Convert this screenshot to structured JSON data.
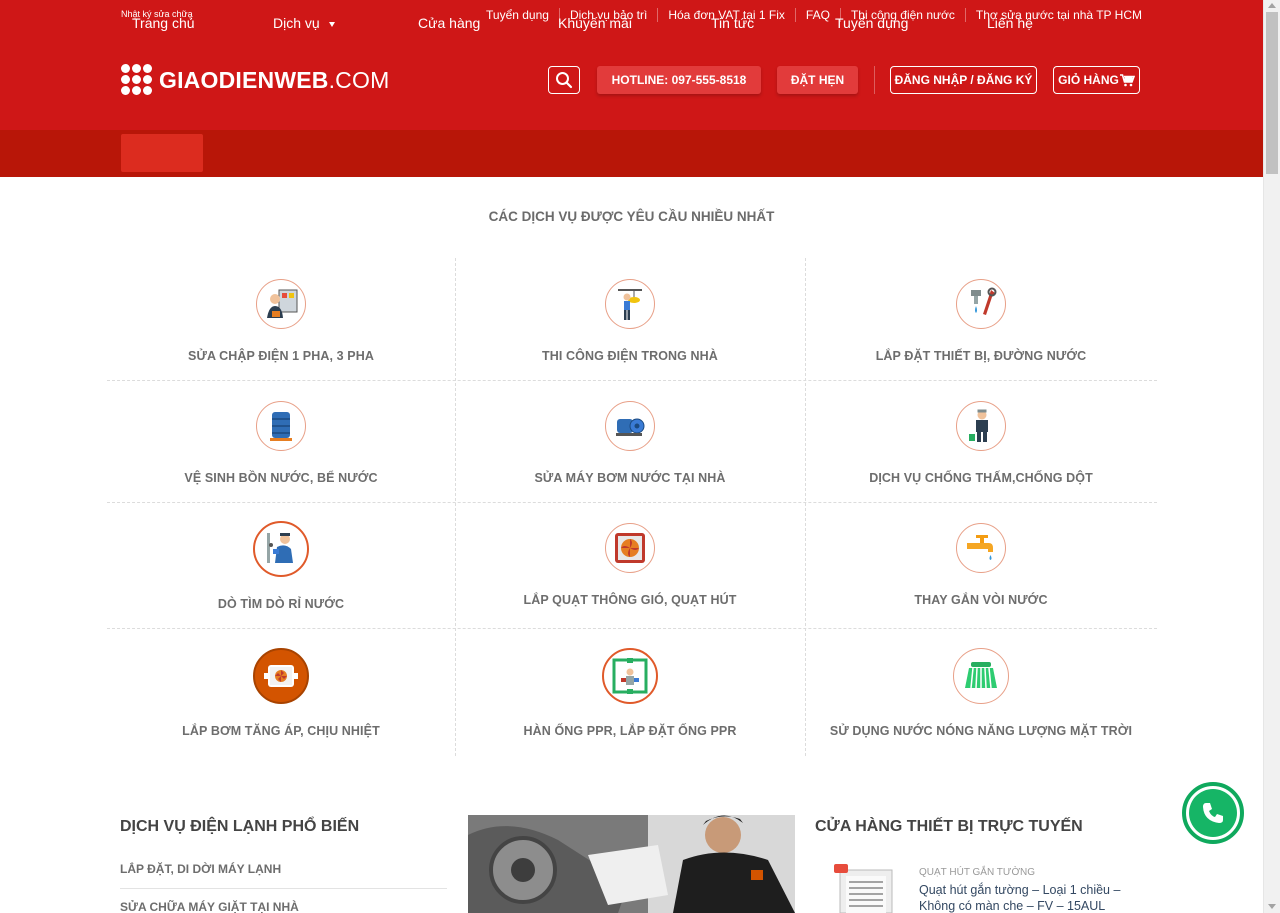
{
  "topbar": {
    "left_text": "Nhật ký sửa chữa",
    "links": [
      "Tuyển dụng",
      "Dịch vụ bảo trì",
      "Hóa đơn VAT tại 1 Fix",
      "FAQ",
      "Thi công điện nước",
      "Thợ sửa nước tại nhà TP HCM"
    ]
  },
  "header": {
    "logo_bold": "GIAODIENWEB",
    "logo_thin": ".COM",
    "hotline": "HOTLINE: 097-555-8518",
    "book": "ĐẶT HẸN",
    "login": "ĐĂNG NHẬP / ĐĂNG KÝ",
    "cart": "GIỎ HÀNG"
  },
  "nav": {
    "items": [
      "Trang chủ",
      "Dịch vụ",
      "Cửa hàng",
      "Khuyến mãi",
      "Tin tức",
      "Tuyển dụng",
      "Liên hệ"
    ]
  },
  "services": {
    "title": "CÁC DỊCH VỤ ĐƯỢC YÊU CẦU NHIỀU NHẤT",
    "items": [
      {
        "label": "SỬA CHẬP ĐIỆN 1 PHA, 3 PHA",
        "icon": "electrician-panel-icon"
      },
      {
        "label": "THI CÔNG ĐIỆN TRONG NHÀ",
        "icon": "ladder-worker-icon"
      },
      {
        "label": "LẮP ĐẶT THIẾT BỊ, ĐƯỜNG NƯỚC",
        "icon": "wrench-faucet-icon"
      },
      {
        "label": "VỆ SINH BỒN NƯỚC, BỂ NƯỚC",
        "icon": "water-tank-icon"
      },
      {
        "label": "SỬA MÁY BƠM NƯỚC TẠI NHÀ",
        "icon": "water-pump-icon"
      },
      {
        "label": "DỊCH VỤ CHỐNG THẤM,CHỐNG DỘT",
        "icon": "painter-icon"
      },
      {
        "label": "DÒ TÌM DÒ RỈ NƯỚC",
        "icon": "leak-detection-icon"
      },
      {
        "label": "LẮP QUẠT THÔNG GIÓ, QUẠT HÚT",
        "icon": "exhaust-fan-icon"
      },
      {
        "label": "THAY GẮN VÒI NƯỚC",
        "icon": "tap-icon"
      },
      {
        "label": "LẮP BƠM TĂNG ÁP, CHỊU NHIỆT",
        "icon": "pressure-pump-icon"
      },
      {
        "label": "HÀN ỐNG PPR, LẮP ĐẶT ỐNG PPR",
        "icon": "ppr-pipe-icon"
      },
      {
        "label": "SỬ DỤNG NƯỚC NÓNG NĂNG LƯỢNG MẶT TRỜI",
        "icon": "solar-heater-icon"
      }
    ]
  },
  "cold_services": {
    "title": "DỊCH VỤ ĐIỆN LẠNH PHỔ BIẾN",
    "items": [
      "LẮP ĐẶT, DI DỜI MÁY LẠNH",
      "SỬA CHỮA MÁY GIẶT TẠI NHÀ"
    ]
  },
  "shop": {
    "title": "CỬA HÀNG THIẾT BỊ TRỰC TUYẾN",
    "product_category": "QUẠT HÚT GẮN TƯỜNG",
    "product_name": "Quạt hút gắn tường – Loại 1 chiều – Không có màn che – FV – 15AUL"
  },
  "colors": {
    "header_red": "#cf1717",
    "nav_red": "#b81608",
    "call_green": "#16b566"
  }
}
